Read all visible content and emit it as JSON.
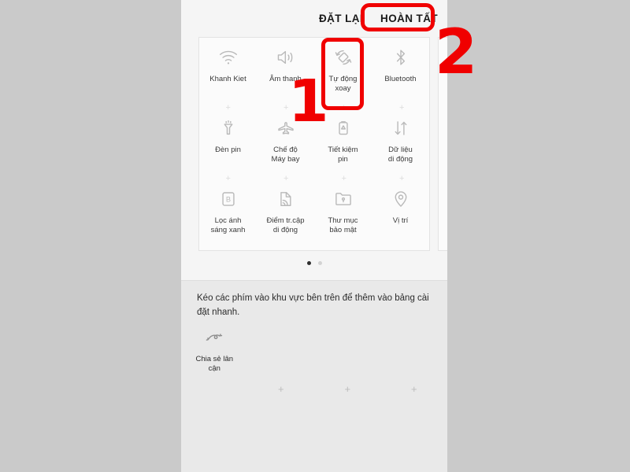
{
  "header": {
    "reset_label": "ĐẶT LẠI",
    "done_label": "HOÀN TẤT"
  },
  "quick_settings": {
    "tiles": [
      {
        "label": "Khanh Kiet",
        "icon": "wifi-icon"
      },
      {
        "label": "Âm thanh",
        "icon": "sound-icon"
      },
      {
        "label": "Tự động\nxoay",
        "icon": "auto-rotate-icon"
      },
      {
        "label": "Bluetooth",
        "icon": "bluetooth-icon"
      },
      {
        "label": "Đèn pin",
        "icon": "flashlight-icon"
      },
      {
        "label": "Chế độ\nMáy bay",
        "icon": "airplane-icon"
      },
      {
        "label": "Tiết kiệm\npin",
        "icon": "battery-saver-icon"
      },
      {
        "label": "Dữ liệu\ndi động",
        "icon": "mobile-data-icon"
      },
      {
        "label": "Lọc ánh\nsáng xanh",
        "icon": "blue-light-filter-icon"
      },
      {
        "label": "Điểm tr.cập\ndi động",
        "icon": "mobile-hotspot-icon"
      },
      {
        "label": "Thư mục\nbảo mật",
        "icon": "secure-folder-icon"
      },
      {
        "label": "Vị trí",
        "icon": "location-icon"
      }
    ],
    "plus_marker": "+",
    "pages": [
      {
        "active": true
      },
      {
        "active": false
      }
    ]
  },
  "drag_area": {
    "instruction": "Kéo các phím vào khu vực bên trên để thêm vào bảng cài đặt nhanh.",
    "tiles": [
      {
        "label": "Chia sẻ lân\ncận",
        "icon": "nearby-share-icon"
      }
    ],
    "plus_marker": "+"
  },
  "annotations": {
    "step_one": "1",
    "step_two": "2",
    "highlight_color": "#f00000"
  }
}
